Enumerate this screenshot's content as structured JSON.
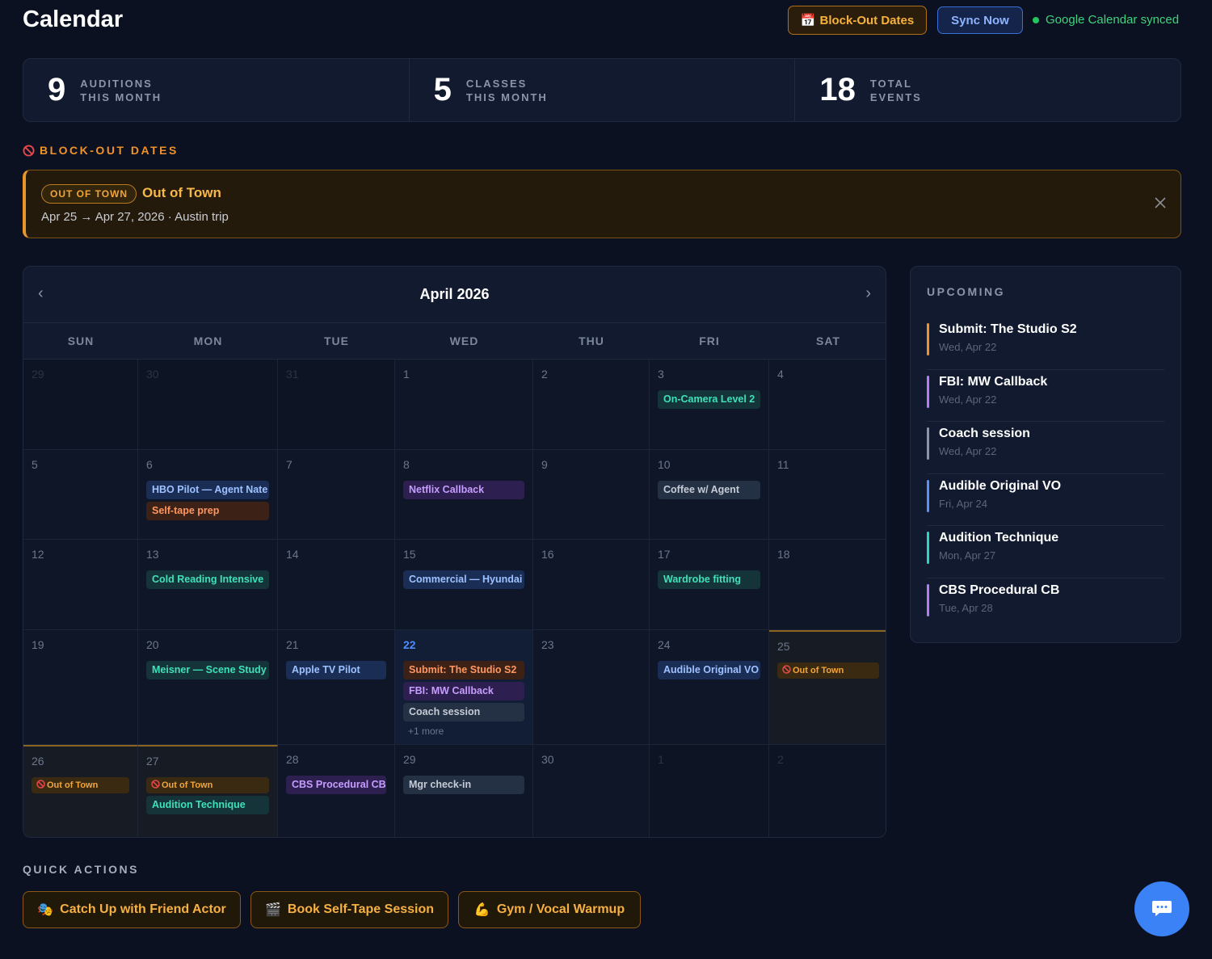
{
  "header": {
    "title": "Calendar",
    "blockout_button": "Block-Out Dates",
    "blockout_button_icon": "calendar-icon",
    "sync_button": "Sync Now",
    "sync_status": "Google Calendar synced"
  },
  "stats": [
    {
      "value": "9",
      "label_line1": "AUDITIONS",
      "label_line2": "THIS MONTH"
    },
    {
      "value": "5",
      "label_line1": "CLASSES",
      "label_line2": "THIS MONTH"
    },
    {
      "value": "18",
      "label_line1": "TOTAL",
      "label_line2": "EVENTS"
    }
  ],
  "blockout": {
    "section_title": "BLOCK-OUT DATES",
    "badge": "OUT OF TOWN",
    "name": "Out of Town",
    "dates": "Apr 25 → Apr 27, 2026 · Austin trip",
    "close_icon": "close-icon"
  },
  "calendar": {
    "month_label": "April 2026",
    "weekdays": [
      "SUN",
      "MON",
      "TUE",
      "WED",
      "THU",
      "FRI",
      "SAT"
    ],
    "days": [
      {
        "num": "29",
        "out": true,
        "events": []
      },
      {
        "num": "30",
        "out": true,
        "events": []
      },
      {
        "num": "31",
        "out": true,
        "events": []
      },
      {
        "num": "1",
        "events": []
      },
      {
        "num": "2",
        "events": []
      },
      {
        "num": "3",
        "events": [
          {
            "label": "On-Camera Level 2",
            "color": "green"
          }
        ]
      },
      {
        "num": "4",
        "events": []
      },
      {
        "num": "5",
        "events": []
      },
      {
        "num": "6",
        "events": [
          {
            "label": "HBO Pilot — Agent Nate",
            "color": "blue"
          },
          {
            "label": "Self-tape prep",
            "color": "orange"
          }
        ]
      },
      {
        "num": "7",
        "events": []
      },
      {
        "num": "8",
        "events": [
          {
            "label": "Netflix Callback",
            "color": "purple"
          }
        ]
      },
      {
        "num": "9",
        "events": []
      },
      {
        "num": "10",
        "events": [
          {
            "label": "Coffee w/ Agent",
            "color": "gray"
          }
        ]
      },
      {
        "num": "11",
        "events": []
      },
      {
        "num": "12",
        "events": []
      },
      {
        "num": "13",
        "events": [
          {
            "label": "Cold Reading Intensive",
            "color": "green"
          }
        ]
      },
      {
        "num": "14",
        "events": []
      },
      {
        "num": "15",
        "events": [
          {
            "label": "Commercial — Hyundai",
            "color": "blue"
          }
        ]
      },
      {
        "num": "16",
        "events": []
      },
      {
        "num": "17",
        "events": [
          {
            "label": "Wardrobe fitting",
            "color": "green"
          }
        ]
      },
      {
        "num": "18",
        "events": []
      },
      {
        "num": "19",
        "events": []
      },
      {
        "num": "20",
        "events": [
          {
            "label": "Meisner — Scene Study",
            "color": "green"
          }
        ]
      },
      {
        "num": "21",
        "events": [
          {
            "label": "Apple TV Pilot",
            "color": "blue"
          }
        ]
      },
      {
        "num": "22",
        "today": true,
        "events": [
          {
            "label": "Submit: The Studio S2",
            "color": "orange"
          },
          {
            "label": "FBI: MW Callback",
            "color": "purple"
          },
          {
            "label": "Coach session",
            "color": "gray"
          }
        ],
        "more": "+1 more"
      },
      {
        "num": "23",
        "events": []
      },
      {
        "num": "24",
        "events": [
          {
            "label": "Audible Original VO",
            "color": "blue"
          }
        ]
      },
      {
        "num": "25",
        "blocked": true,
        "events": [
          {
            "label": "Out of Town",
            "color": "blockev"
          }
        ]
      },
      {
        "num": "26",
        "blocked": true,
        "events": [
          {
            "label": "Out of Town",
            "color": "blockev"
          }
        ]
      },
      {
        "num": "27",
        "blocked": true,
        "events": [
          {
            "label": "Out of Town",
            "color": "blockev"
          },
          {
            "label": "Audition Technique",
            "color": "green"
          }
        ]
      },
      {
        "num": "28",
        "events": [
          {
            "label": "CBS Procedural CB",
            "color": "purple"
          }
        ]
      },
      {
        "num": "29",
        "events": [
          {
            "label": "Mgr check-in",
            "color": "gray"
          }
        ]
      },
      {
        "num": "30",
        "events": []
      },
      {
        "num": "1",
        "out": true,
        "events": []
      },
      {
        "num": "2",
        "out": true,
        "events": []
      }
    ]
  },
  "upcoming": {
    "title": "UPCOMING",
    "items": [
      {
        "name": "Submit: The Studio S2",
        "date": "Wed, Apr 22",
        "color": "#f0922a"
      },
      {
        "name": "FBI: MW Callback",
        "date": "Wed, Apr 22",
        "color": "#b57cf6"
      },
      {
        "name": "Coach session",
        "date": "Wed, Apr 22",
        "color": "#8b95a8"
      },
      {
        "name": "Audible Original VO",
        "date": "Fri, Apr 24",
        "color": "#5b8ff9"
      },
      {
        "name": "Audition Technique",
        "date": "Mon, Apr 27",
        "color": "#2dd4bf"
      },
      {
        "name": "CBS Procedural CB",
        "date": "Tue, Apr 28",
        "color": "#b57cf6"
      }
    ]
  },
  "quick_actions": {
    "title": "QUICK ACTIONS",
    "buttons": [
      {
        "label": "Catch Up with Friend Actor",
        "icon": "theater-masks-icon",
        "glyph": "🎭"
      },
      {
        "label": "Book Self-Tape Session",
        "icon": "clapperboard-icon",
        "glyph": "🎬"
      },
      {
        "label": "Gym / Vocal Warmup",
        "icon": "flexed-biceps-icon",
        "glyph": "💪"
      }
    ]
  },
  "chat_icon": "chat-bubble-icon"
}
